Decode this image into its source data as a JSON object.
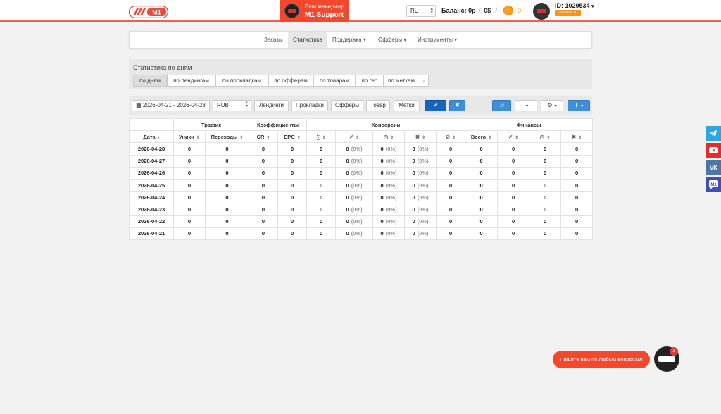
{
  "header": {
    "logo_text": "M1",
    "manager_label": "Ваш менеджер",
    "manager_name": "M1 Support",
    "lang": "RU",
    "balance_label": "Баланс:",
    "balance_rub": "0р",
    "balance_usd": "0$",
    "coins": "0",
    "user_id": "ID: 1029534",
    "user_badge": "НОВИЧОК"
  },
  "nav": {
    "items": [
      {
        "label": "Заказы"
      },
      {
        "label": "Статистика"
      },
      {
        "label": "Поддержка ▾"
      },
      {
        "label": "Офферы ▾"
      },
      {
        "label": "Инструменты ▾"
      }
    ]
  },
  "panel": {
    "title": "Статистика по дням",
    "tabs": [
      {
        "label": "по дням"
      },
      {
        "label": "по лендингам"
      },
      {
        "label": "по прокладкам"
      },
      {
        "label": "по офферам"
      },
      {
        "label": "по товарам"
      },
      {
        "label": "по гео"
      },
      {
        "label": "по меткам"
      }
    ]
  },
  "toolbar": {
    "date_range": "2026-04-21 - 2026-04-28",
    "currency": "RUB",
    "landings": "Лендинги",
    "prelands": "Прокладки",
    "offers": "Офферы",
    "product": "Товар",
    "tags": "Метки"
  },
  "table": {
    "groups": [
      "Трафик",
      "Коэффициенты",
      "Конверсии",
      "Финансы"
    ],
    "cols": [
      "Дата",
      "Уники",
      "Переходы",
      "CR",
      "EPC",
      "∑",
      "Всего"
    ],
    "rows": [
      {
        "date": "2026-04-28"
      },
      {
        "date": "2026-04-27"
      },
      {
        "date": "2026-04-26"
      },
      {
        "date": "2026-04-25"
      },
      {
        "date": "2026-04-24"
      },
      {
        "date": "2026-04-23"
      },
      {
        "date": "2026-04-22"
      },
      {
        "date": "2026-04-21"
      }
    ],
    "zero": "0",
    "pct": "(0%)"
  },
  "chat": {
    "prompt": "Пишите нам по любым вопросам!",
    "count": "1"
  },
  "colors": {
    "brand": "#f4482e",
    "primary": "#1565c0",
    "info": "#3e8ed8"
  }
}
